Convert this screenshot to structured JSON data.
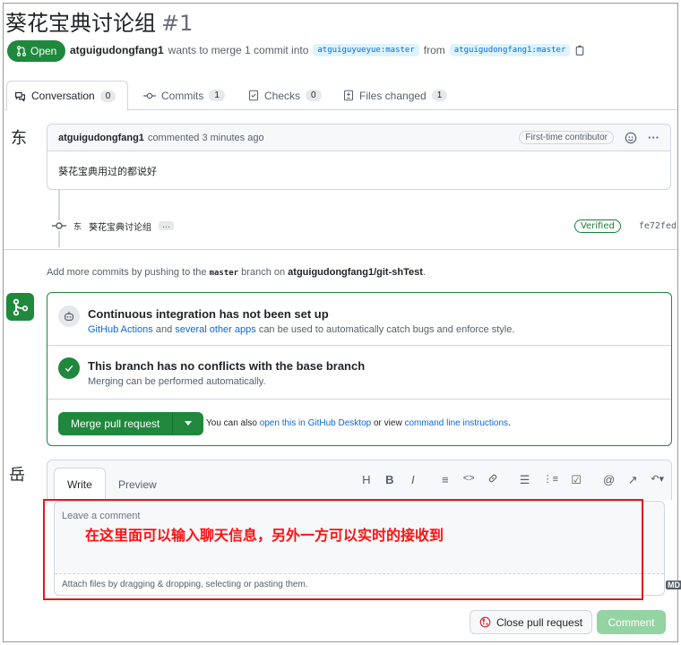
{
  "pr": {
    "title": "葵花宝典讨论组",
    "number": "#1",
    "state": "Open",
    "author": "atguigudongfang1",
    "merge_text": "wants to merge 1 commit into",
    "base_branch": "atguiguyueyue:master",
    "from_text": "from",
    "head_branch": "atguigudongfang1:master"
  },
  "tabs": [
    {
      "label": "Conversation",
      "count": "0"
    },
    {
      "label": "Commits",
      "count": "1"
    },
    {
      "label": "Checks",
      "count": "0"
    },
    {
      "label": "Files changed",
      "count": "1"
    }
  ],
  "comment": {
    "avatar": "东",
    "author": "atguigudongfang1",
    "action": "commented 3 minutes ago",
    "badge": "First-time contributor",
    "body": "葵花宝典用过的都说好",
    "more": "···"
  },
  "commit": {
    "avatar": "东",
    "message": "葵花宝典讨论组",
    "ellipsis": "…",
    "verified": "Verified",
    "sha": "fe72fed"
  },
  "add_more": {
    "prefix": "Add more commits by pushing to the",
    "branch": "master",
    "middle": "branch on",
    "repo": "atguigudongfang1/git-shTest",
    "suffix": "."
  },
  "checks": {
    "ci_title": "Continuous integration has not been set up",
    "ci_link1": "GitHub Actions",
    "ci_and": "and",
    "ci_link2": "several other apps",
    "ci_rest": "can be used to automatically catch bugs and enforce style.",
    "conflict_title": "This branch has no conflicts with the base branch",
    "conflict_sub": "Merging can be performed automatically."
  },
  "merge": {
    "button": "Merge pull request",
    "note_prefix": "You can also",
    "note_link1": "open this in GitHub Desktop",
    "note_mid": "or view",
    "note_link2": "command line instructions",
    "note_suffix": "."
  },
  "editor": {
    "avatar": "岳",
    "tab_write": "Write",
    "tab_preview": "Preview",
    "toolbar": [
      "H",
      "B",
      "I",
      "≡",
      "<>",
      "🔗",
      "☰",
      "⋮≡",
      "☑",
      "@",
      "↗",
      "↶▾"
    ],
    "placeholder": "Leave a comment",
    "overlay": "在这里面可以输入聊天信息，另外一方可以实时的接收到",
    "attach": "Attach files by dragging & dropping, selecting or pasting them.",
    "md_badge": "MD"
  },
  "actions": {
    "close": "Close pull request",
    "comment": "Comment"
  },
  "colors": {
    "green": "#1f883d",
    "link": "#0969da",
    "annotation_red": "#e0191f"
  }
}
